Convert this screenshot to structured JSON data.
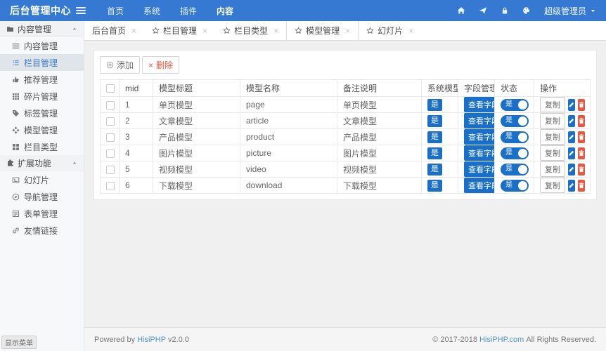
{
  "topbar": {
    "title": "后台管理中心",
    "menu": [
      {
        "label": "首页",
        "active": false
      },
      {
        "label": "系统",
        "active": false
      },
      {
        "label": "插件",
        "active": false
      },
      {
        "label": "内容",
        "active": true
      }
    ],
    "icons": [
      "home",
      "paper-plane",
      "lock",
      "palette"
    ],
    "user": "超级管理员"
  },
  "sidebar": {
    "sections": [
      {
        "label": "内容管理",
        "icon": "folder",
        "items": [
          {
            "label": "内容管理",
            "icon": "lines",
            "active": false
          },
          {
            "label": "栏目管理",
            "icon": "list",
            "active": true
          },
          {
            "label": "推荐管理",
            "icon": "thumb",
            "active": false
          },
          {
            "label": "碎片管理",
            "icon": "grid",
            "active": false
          },
          {
            "label": "标签管理",
            "icon": "tag",
            "active": false
          },
          {
            "label": "模型管理",
            "icon": "model",
            "active": false
          },
          {
            "label": "栏目类型",
            "icon": "squares",
            "active": false
          }
        ]
      },
      {
        "label": "扩展功能",
        "icon": "puzzle",
        "items": [
          {
            "label": "幻灯片",
            "icon": "image",
            "active": false
          },
          {
            "label": "导航管理",
            "icon": "compass",
            "active": false
          },
          {
            "label": "表单管理",
            "icon": "form",
            "active": false
          },
          {
            "label": "友情链接",
            "icon": "link",
            "active": false
          }
        ]
      }
    ],
    "show_menu_label": "显示菜单"
  },
  "tabs": [
    {
      "label": "后台首页",
      "starred": false,
      "active": false
    },
    {
      "label": "栏目管理",
      "starred": true,
      "active": false
    },
    {
      "label": "栏目类型",
      "starred": true,
      "active": false
    },
    {
      "label": "模型管理",
      "starred": true,
      "active": true
    },
    {
      "label": "幻灯片",
      "starred": true,
      "active": false
    }
  ],
  "toolbar": {
    "add_label": "添加",
    "delete_label": "删除"
  },
  "table": {
    "headers": [
      "mid",
      "模型标题",
      "模型名称",
      "备注说明",
      "系统模型",
      "字段管理",
      "状态",
      "操作"
    ],
    "system_badge": "是",
    "fields_button": "查看字段",
    "status_on": "是",
    "copy_label": "复制",
    "rows": [
      {
        "mid": "1",
        "title": "单页模型",
        "name": "page",
        "note": "单页模型"
      },
      {
        "mid": "2",
        "title": "文章模型",
        "name": "article",
        "note": "文章模型"
      },
      {
        "mid": "3",
        "title": "产品模型",
        "name": "product",
        "note": "产品模型"
      },
      {
        "mid": "4",
        "title": "图片模型",
        "name": "picture",
        "note": "图片模型"
      },
      {
        "mid": "5",
        "title": "视频模型",
        "name": "video",
        "note": "视频模型"
      },
      {
        "mid": "6",
        "title": "下载模型",
        "name": "download",
        "note": "下载模型"
      }
    ]
  },
  "footer": {
    "powered_prefix": "Powered by",
    "powered_link": "HisiPHP",
    "powered_suffix": "v2.0.0",
    "copyright_prefix": "© 2017-2018",
    "copyright_link": "HisiPHP.com",
    "copyright_suffix": "All Rights Reserved."
  },
  "colors": {
    "topbar_blue": "#3679d2",
    "control_blue": "#1a6fc8",
    "danger_red": "#e8573f",
    "link_blue": "#4a97d2",
    "content_bg": "#f0f0f0"
  }
}
